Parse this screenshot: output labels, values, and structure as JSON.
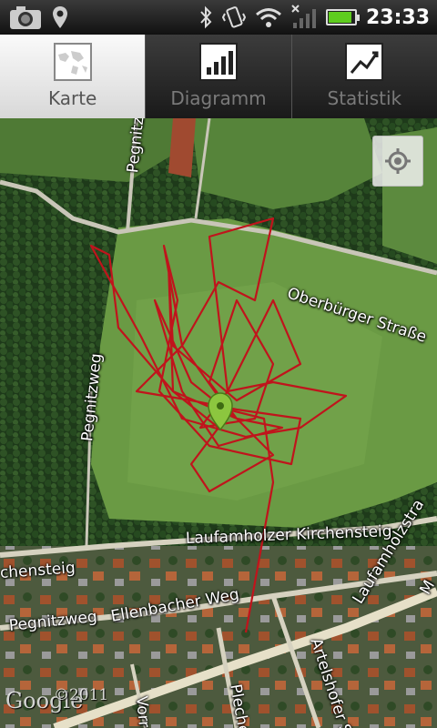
{
  "status_bar": {
    "time": "23:33",
    "icons": [
      "camera-icon",
      "location-icon",
      "bluetooth-icon",
      "vibrate-icon",
      "wifi-icon",
      "signal-icon",
      "battery-icon"
    ],
    "battery_level": 0.85,
    "battery_color": "#5ecc1e"
  },
  "tabs": [
    {
      "label": "Karte",
      "icon": "map-icon",
      "active": true
    },
    {
      "label": "Diagramm",
      "icon": "bar-chart-icon",
      "active": false
    },
    {
      "label": "Statistik",
      "icon": "line-chart-icon",
      "active": false
    }
  ],
  "map": {
    "street_labels": {
      "pegnitz_top": "Pegnitz",
      "oberburger": "Oberbürger Straße",
      "pegnitzweg_vertical": "Pegnitzweg",
      "kirchensteig": "Laufamholzer Kirchensteig",
      "kirchensteig_left": "chensteig",
      "laufamholz_str": "Laufamholzstra",
      "ellenbacher": "Ellenbacher Weg",
      "pegnitzweg_bottom": "Pegnitzweg",
      "artelshofer": "Artelshofer Str",
      "plecher": "Plecher",
      "vorra": "Vorra",
      "right_edge": "M"
    },
    "attribution": "©2011",
    "logo": "Google",
    "track_color": "#c0141c",
    "marker_color": "#8cc63f"
  }
}
